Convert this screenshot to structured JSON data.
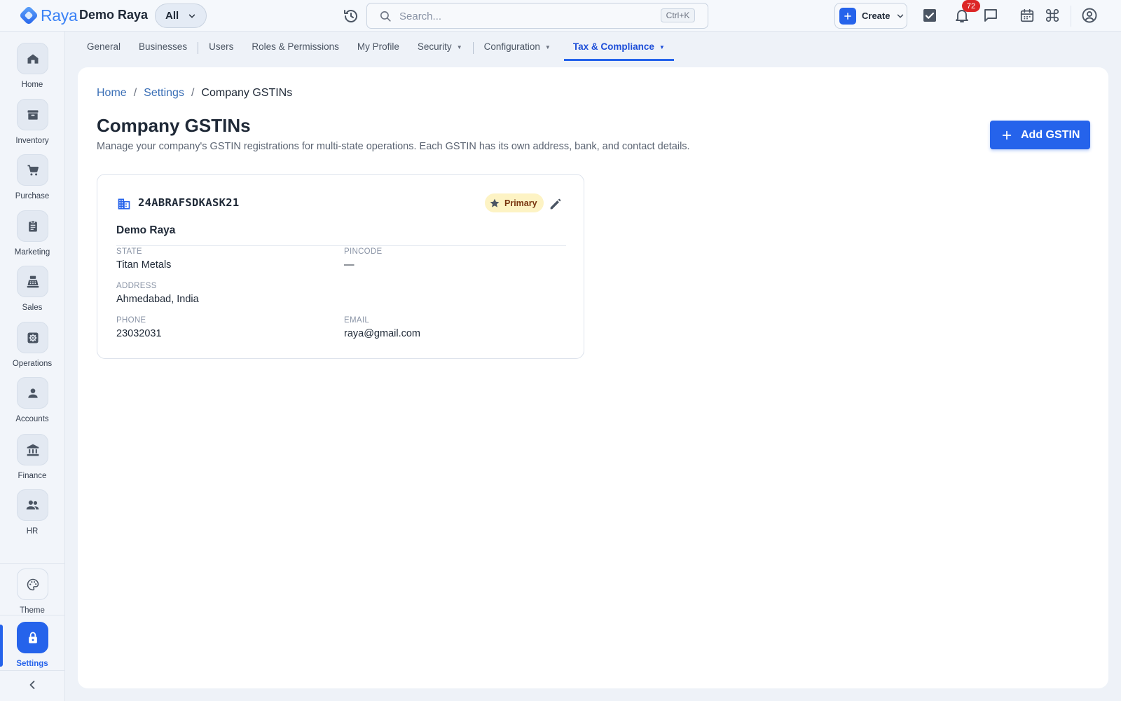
{
  "app": {
    "brand": "Raya",
    "company": "Demo Raya",
    "scope": "All"
  },
  "search": {
    "placeholder": "Search...",
    "shortcut": "Ctrl+K"
  },
  "header": {
    "create_label": "Create",
    "notification_count": "72",
    "icons": [
      "history-icon",
      "search-icon",
      "plus-icon",
      "chevron-down-icon",
      "task-check-icon",
      "bell-icon",
      "chat-icon",
      "calendar-icon",
      "command-icon",
      "account-circle-icon"
    ]
  },
  "sidebar": {
    "items": [
      {
        "label": "Home",
        "icon": "home-icon"
      },
      {
        "label": "Inventory",
        "icon": "archive-icon"
      },
      {
        "label": "Purchase",
        "icon": "cart-icon"
      },
      {
        "label": "Marketing",
        "icon": "clipboard-icon"
      },
      {
        "label": "Sales",
        "icon": "register-icon"
      },
      {
        "label": "Operations",
        "icon": "gear-box-icon"
      },
      {
        "label": "Accounts",
        "icon": "person-icon"
      },
      {
        "label": "Finance",
        "icon": "bank-icon"
      },
      {
        "label": "HR",
        "icon": "people-icon"
      }
    ],
    "bottom_items": [
      {
        "label": "Theme",
        "icon": "palette-icon"
      },
      {
        "label": "Settings",
        "icon": "lock-icon",
        "active": true
      }
    ]
  },
  "tabs": [
    {
      "label": "General"
    },
    {
      "label": "Businesses"
    },
    {
      "label": "Users"
    },
    {
      "label": "Roles & Permissions"
    },
    {
      "label": "My Profile"
    },
    {
      "label": "Security",
      "dropdown": true
    },
    {
      "label": "Configuration",
      "dropdown": true
    },
    {
      "label": "Tax & Compliance",
      "dropdown": true,
      "active": true
    }
  ],
  "breadcrumb": {
    "home": "Home",
    "settings": "Settings",
    "current": "Company GSTINs",
    "separator": "/"
  },
  "page": {
    "title": "Company GSTINs",
    "subtitle": "Manage your company's GSTIN registrations for multi-state operations. Each GSTIN has its own address, bank, and contact details.",
    "add_button": "Add GSTIN"
  },
  "gstin_card": {
    "gstin": "24ABRAFSDKASK21",
    "badge": "Primary",
    "business_name": "Demo Raya",
    "state_label": "STATE",
    "state_value": "Titan Metals",
    "pincode_label": "PINCODE",
    "pincode_value": "—",
    "address_label": "ADDRESS",
    "address_value": "Ahmedabad, India",
    "phone_label": "PHONE",
    "phone_value": "23032031",
    "email_label": "EMAIL",
    "email_value": "raya@gmail.com"
  },
  "colors": {
    "accent": "#2563eb",
    "badge_bg": "#fdf3c4",
    "notification": "#dc2626"
  }
}
